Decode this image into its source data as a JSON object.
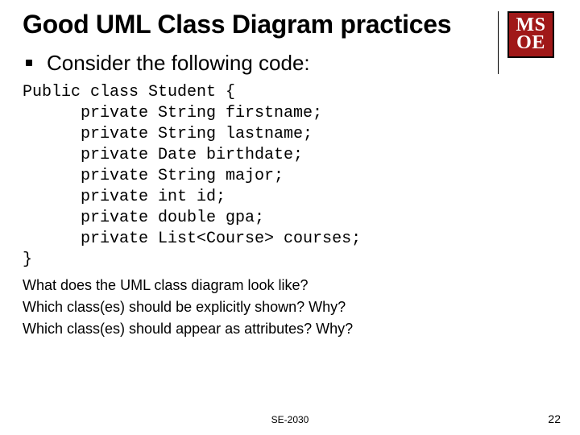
{
  "logo": {
    "line1": "MS",
    "line2": "OE"
  },
  "title": "Good UML Class Diagram practices",
  "lead": "Consider the following code:",
  "code_lines": [
    "Public class Student {",
    "      private String firstname;",
    "      private String lastname;",
    "      private Date birthdate;",
    "      private String major;",
    "      private int id;",
    "      private double gpa;",
    "      private List<Course> courses;",
    "}"
  ],
  "questions": [
    "What does the UML class diagram look like?",
    "Which class(es) should be explicitly shown? Why?",
    "Which class(es) should appear as attributes? Why?"
  ],
  "footer": {
    "center": "SE-2030",
    "page": "22"
  }
}
